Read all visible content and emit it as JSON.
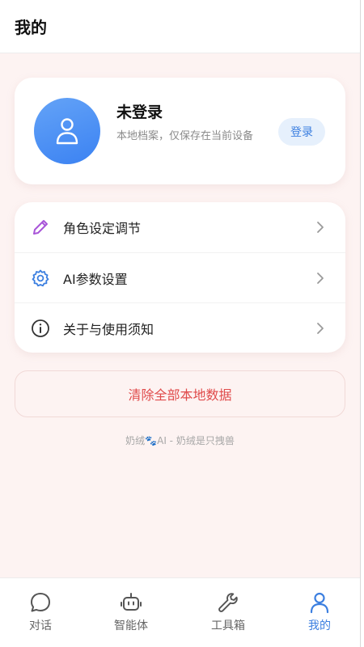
{
  "header": {
    "title": "我的"
  },
  "profile": {
    "name": "未登录",
    "description": "本地档案，仅保存在当前设备",
    "login_label": "登录"
  },
  "menu": {
    "items": [
      {
        "label": "角色设定调节",
        "icon": "pencil-icon"
      },
      {
        "label": "AI参数设置",
        "icon": "gear-icon"
      },
      {
        "label": "关于与使用须知",
        "icon": "info-icon"
      }
    ]
  },
  "actions": {
    "clear_label": "清除全部本地数据"
  },
  "footer": {
    "text": "奶绒🐾AI - 奶绒是只拽兽"
  },
  "tabbar": {
    "tabs": [
      {
        "label": "对话",
        "icon": "chat-bubble-icon",
        "active": false
      },
      {
        "label": "智能体",
        "icon": "robot-icon",
        "active": false
      },
      {
        "label": "工具箱",
        "icon": "wrench-icon",
        "active": false
      },
      {
        "label": "我的",
        "icon": "user-icon",
        "active": true
      }
    ]
  },
  "colors": {
    "accent": "#3c7fe0",
    "danger": "#e04b4b",
    "background": "#fdf3f2",
    "pencil": "#a855d8"
  }
}
